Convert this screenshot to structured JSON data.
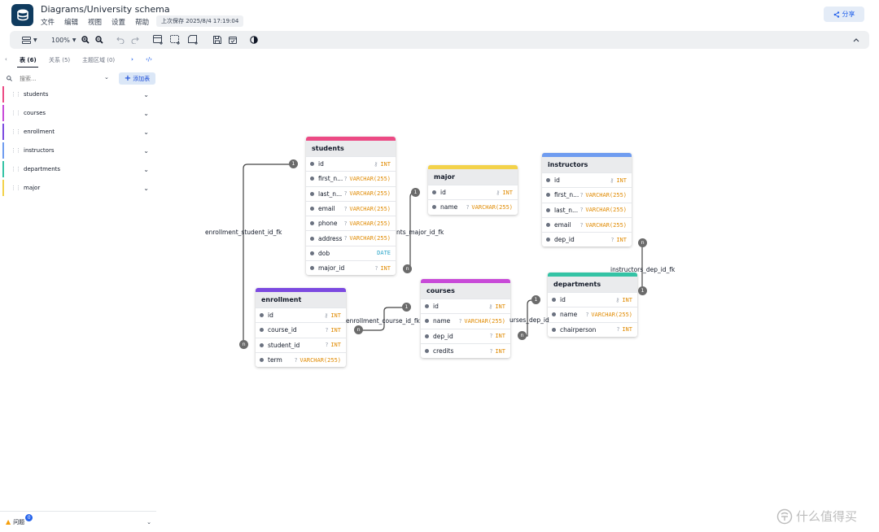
{
  "header": {
    "title": "Diagrams/University schema",
    "menu": [
      "文件",
      "编辑",
      "视图",
      "设置",
      "帮助"
    ],
    "last_saved": "上次保存 2025/8/4 17:19:04",
    "share_label": "分享"
  },
  "toolbar": {
    "zoom": "100%"
  },
  "sidebar": {
    "tabs": [
      {
        "label": "表 (6)"
      },
      {
        "label": "关系 (5)"
      },
      {
        "label": "主题区域 (0)"
      }
    ],
    "search_placeholder": "搜索...",
    "add_table_label": "添加表",
    "tables": [
      {
        "name": "students",
        "color": "#ec4a84"
      },
      {
        "name": "courses",
        "color": "#c84ad8"
      },
      {
        "name": "enrollment",
        "color": "#7c4ae0"
      },
      {
        "name": "instructors",
        "color": "#6f9cf0"
      },
      {
        "name": "departments",
        "color": "#34c3a5"
      },
      {
        "name": "major",
        "color": "#f3d24a"
      }
    ],
    "issues_label": "问题",
    "issues_count": "0"
  },
  "entities": {
    "students": {
      "title": "students",
      "color": "#ec4a84",
      "fields": [
        {
          "name": "id",
          "type": "INT",
          "key": true
        },
        {
          "name": "first_n...",
          "type": "VARCHAR(255)",
          "nullable": true
        },
        {
          "name": "last_n...",
          "type": "VARCHAR(255)",
          "nullable": true
        },
        {
          "name": "email",
          "type": "VARCHAR(255)",
          "nullable": true
        },
        {
          "name": "phone",
          "type": "VARCHAR(255)",
          "nullable": true
        },
        {
          "name": "address",
          "type": "VARCHAR(255)",
          "nullable": true
        },
        {
          "name": "dob",
          "type": "DATE"
        },
        {
          "name": "major_id",
          "type": "INT",
          "nullable": true
        }
      ]
    },
    "major": {
      "title": "major",
      "color": "#f3d24a",
      "fields": [
        {
          "name": "id",
          "type": "INT",
          "key": true
        },
        {
          "name": "name",
          "type": "VARCHAR(255)",
          "nullable": true
        }
      ]
    },
    "instructors": {
      "title": "instructors",
      "color": "#6f9cf0",
      "fields": [
        {
          "name": "id",
          "type": "INT",
          "key": true
        },
        {
          "name": "first_n...",
          "type": "VARCHAR(255)",
          "nullable": true
        },
        {
          "name": "last_n...",
          "type": "VARCHAR(255)",
          "nullable": true
        },
        {
          "name": "email",
          "type": "VARCHAR(255)",
          "nullable": true
        },
        {
          "name": "dep_id",
          "type": "INT",
          "nullable": true
        }
      ]
    },
    "enrollment": {
      "title": "enrollment",
      "color": "#7c4ae0",
      "fields": [
        {
          "name": "id",
          "type": "INT",
          "key": true
        },
        {
          "name": "course_id",
          "type": "INT",
          "nullable": true
        },
        {
          "name": "student_id",
          "type": "INT",
          "nullable": true
        },
        {
          "name": "term",
          "type": "VARCHAR(255)",
          "nullable": true
        }
      ]
    },
    "courses": {
      "title": "courses",
      "color": "#c84ad8",
      "fields": [
        {
          "name": "id",
          "type": "INT",
          "key": true
        },
        {
          "name": "name",
          "type": "VARCHAR(255)",
          "nullable": true
        },
        {
          "name": "dep_id",
          "type": "INT",
          "nullable": true
        },
        {
          "name": "credits",
          "type": "INT",
          "nullable": true
        }
      ]
    },
    "departments": {
      "title": "departments",
      "color": "#34c3a5",
      "fields": [
        {
          "name": "id",
          "type": "INT",
          "key": true
        },
        {
          "name": "name",
          "type": "VARCHAR(255)",
          "nullable": true
        },
        {
          "name": "chairperson",
          "type": "INT",
          "nullable": true
        }
      ]
    }
  },
  "relationships": {
    "enrollment_student": "enrollment_student_id_fk",
    "students_major": "nts_major_id_fk",
    "instructors_dep": "instructors_dep_id_fk",
    "enrollment_course": "enrollment_course_id_fk",
    "courses_dep": "urses_dep_id"
  },
  "cardinality": {
    "one": "1",
    "many": "n"
  },
  "watermark": "什么值得买"
}
